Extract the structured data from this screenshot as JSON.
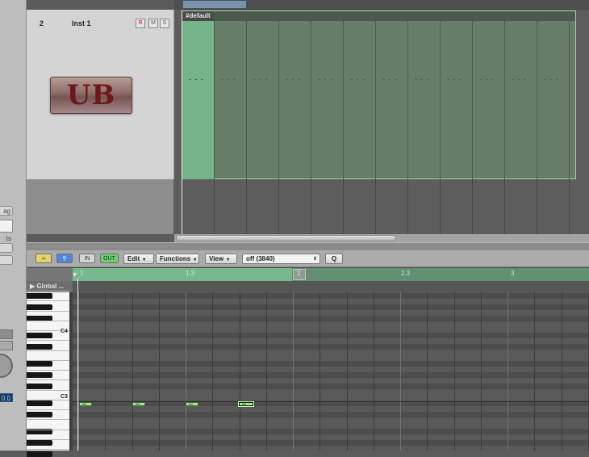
{
  "left_strip": {
    "partial_labels": [
      "ag",
      "ts"
    ],
    "value_field": "0.0"
  },
  "track": {
    "number": "2",
    "name": "Inst 1",
    "buttons": {
      "record": "R",
      "mute": "M",
      "solo": "S"
    },
    "plugin_logo_text": "UB"
  },
  "arrange": {
    "region_name": "#default",
    "region_content_marks": "- - -"
  },
  "piano_roll": {
    "toolbar": {
      "edit_label": "Edit",
      "functions_label": "Functions",
      "view_label": "View",
      "quantize_value": "off (3840)",
      "q_label": "Q",
      "in_label": "IN",
      "out_label": "OUT",
      "menu_arrow": "▾",
      "select_arrow": "⇕"
    },
    "ruler": {
      "labels": [
        "1",
        "1.3",
        "2",
        "2.3",
        "3"
      ]
    },
    "global_tracks_label": "▶ Global ...",
    "key_labels": {
      "c4": "C4",
      "c3": "C3"
    },
    "notes_count_visible": 4,
    "colors": {
      "note_fill": "#9ef08e",
      "region_fill": "#687c6a",
      "region_selection": "#75b48b",
      "ruler": "#638f73"
    }
  }
}
